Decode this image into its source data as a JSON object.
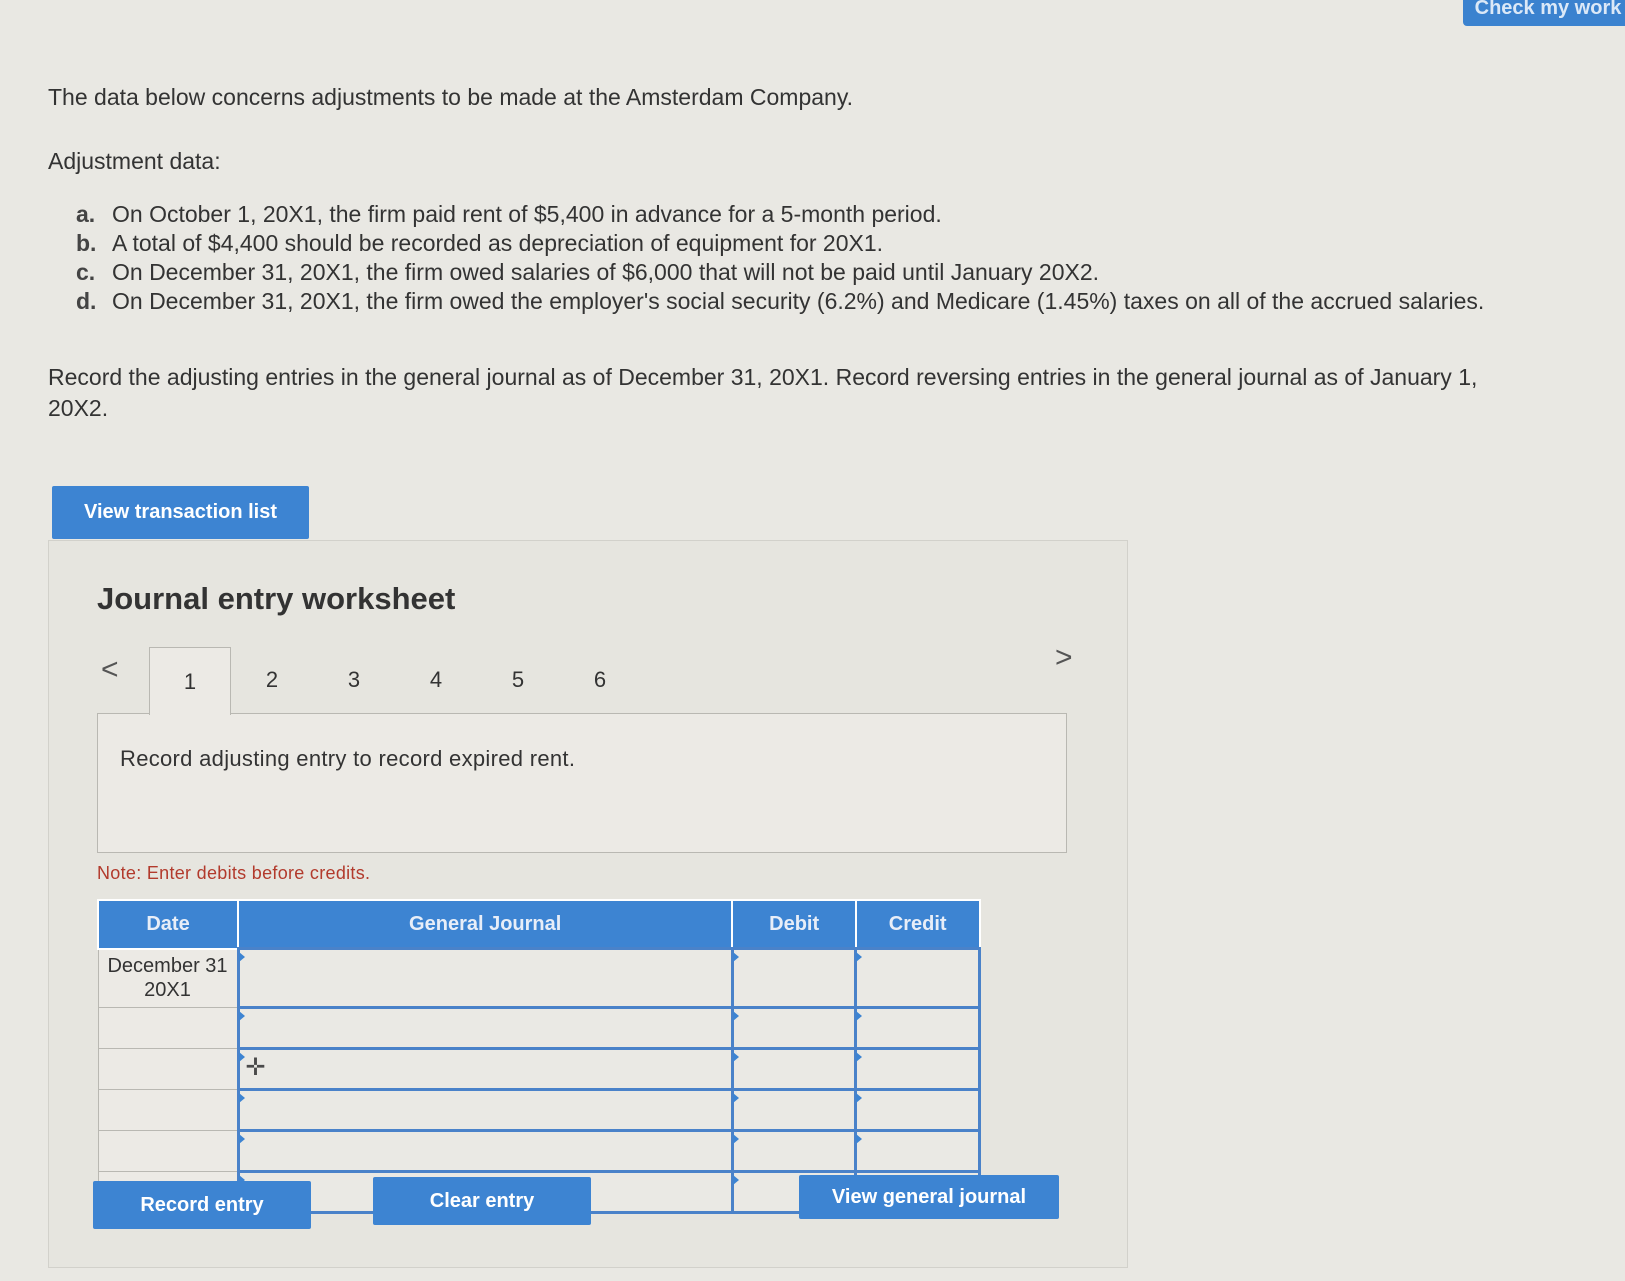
{
  "header": {
    "check_button_label": "Check my work"
  },
  "problem": {
    "intro": "The data below concerns adjustments to be made at the Amsterdam Company.",
    "adjustment_label": "Adjustment data:",
    "items": [
      {
        "letter": "a.",
        "text": "On October 1, 20X1, the firm paid rent of $5,400 in advance for a 5-month period."
      },
      {
        "letter": "b.",
        "text": "A total of $4,400 should be recorded as depreciation of equipment for 20X1."
      },
      {
        "letter": "c.",
        "text": "On December 31, 20X1, the firm owed salaries of $6,000 that will not be paid until January 20X2."
      },
      {
        "letter": "d.",
        "text": "On December 31, 20X1, the firm owed the employer's social security (6.2%) and Medicare (1.45%) taxes on all of the accrued salaries."
      }
    ],
    "instructions": "Record the adjusting entries in the general journal as of December 31, 20X1. Record reversing entries in the general journal as of January 1, 20X2."
  },
  "buttons": {
    "view_transaction_list": "View transaction list",
    "record_entry": "Record entry",
    "clear_entry": "Clear entry",
    "view_general_journal": "View general journal"
  },
  "worksheet": {
    "title": "Journal entry worksheet",
    "nav_prev": "<",
    "nav_next": ">",
    "tabs": [
      "1",
      "2",
      "3",
      "4",
      "5",
      "6"
    ],
    "active_tab": "1",
    "prompt": "Record adjusting entry to record expired rent.",
    "note": "Note: Enter debits before credits.",
    "columns": {
      "date": "Date",
      "general_journal": "General Journal",
      "debit": "Debit",
      "credit": "Credit"
    },
    "rows": [
      {
        "date": "December 31 20X1",
        "account": "",
        "debit": "",
        "credit": ""
      },
      {
        "date": "",
        "account": "",
        "debit": "",
        "credit": ""
      },
      {
        "date": "",
        "account": "",
        "debit": "",
        "credit": ""
      },
      {
        "date": "",
        "account": "",
        "debit": "",
        "credit": ""
      },
      {
        "date": "",
        "account": "",
        "debit": "",
        "credit": ""
      },
      {
        "date": "",
        "account": "",
        "debit": "",
        "credit": ""
      }
    ]
  }
}
